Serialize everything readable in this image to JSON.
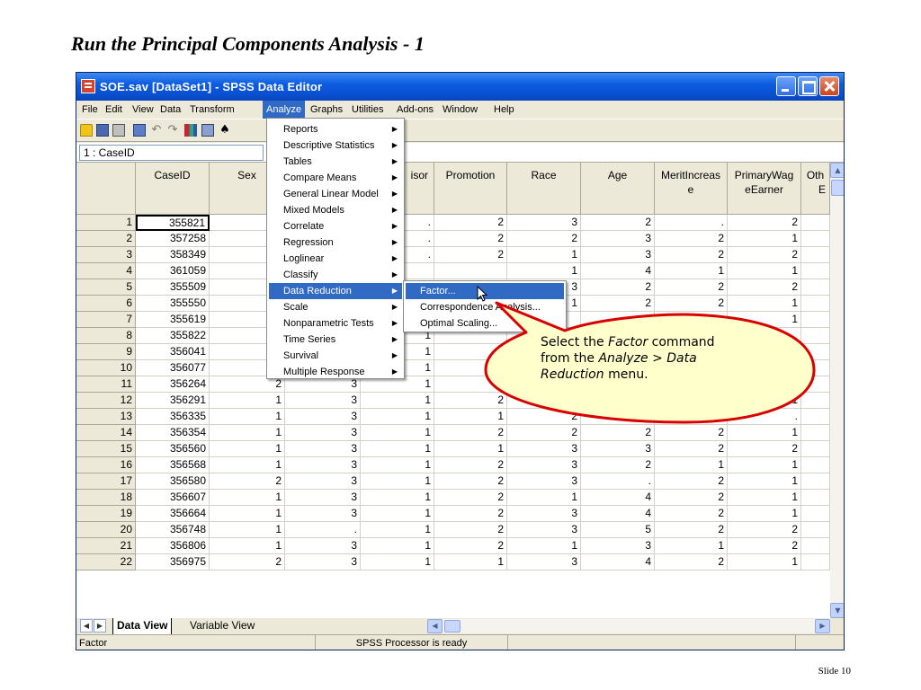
{
  "slide": {
    "title": "Run the Principal Components Analysis - 1",
    "number": "Slide 10"
  },
  "window": {
    "title": "SOE.sav [DataSet1] - SPSS Data Editor"
  },
  "menubar": [
    "File",
    "Edit",
    "View",
    "Data",
    "Transform",
    "Analyze",
    "Graphs",
    "Utilities",
    "Add-ons",
    "Window",
    "Help"
  ],
  "toolbar_icons": [
    "open-icon",
    "save-icon",
    "print-icon",
    "dialog-recall-icon",
    "undo-icon",
    "redo-icon",
    "goto-case-icon",
    "variables-icon",
    "find-icon"
  ],
  "cell_editor": {
    "ref": "1 : CaseID"
  },
  "columns": [
    "CaseID",
    "Sex",
    "",
    "isor",
    "Promotion",
    "Race",
    "Age",
    "MeritIncrease",
    "PrimaryWageEarner",
    "Oth E"
  ],
  "column_headers_display": {
    "c0": "CaseID",
    "c1": "Sex",
    "c3": "isor",
    "c4": "Promotion",
    "c5": "Race",
    "c6": "Age",
    "c7a": "MeritIncreas",
    "c7b": "e",
    "c8a": "PrimaryWag",
    "c8b": "eEarner",
    "c9a": "Oth",
    "c9b": "E"
  },
  "rows": [
    {
      "n": "1",
      "v": [
        "355821",
        "",
        "",
        ".",
        "2",
        "3",
        "2",
        ".",
        "2"
      ]
    },
    {
      "n": "2",
      "v": [
        "357258",
        "",
        "",
        ".",
        "2",
        "2",
        "3",
        "2",
        "1"
      ]
    },
    {
      "n": "3",
      "v": [
        "358349",
        "",
        "",
        ".",
        "2",
        "1",
        "3",
        "2",
        "2"
      ]
    },
    {
      "n": "4",
      "v": [
        "361059",
        "",
        "",
        "",
        "",
        "1",
        "4",
        "1",
        "1"
      ]
    },
    {
      "n": "5",
      "v": [
        "355509",
        "",
        "",
        "",
        "",
        "3",
        "2",
        "2",
        "2"
      ]
    },
    {
      "n": "6",
      "v": [
        "355550",
        "",
        "",
        "",
        "",
        "1",
        "2",
        "2",
        "1"
      ]
    },
    {
      "n": "7",
      "v": [
        "355619",
        "",
        "",
        "1",
        "",
        "",
        "",
        "",
        "1"
      ]
    },
    {
      "n": "8",
      "v": [
        "355822",
        "",
        "",
        "1",
        "",
        "",
        "",
        "",
        ""
      ]
    },
    {
      "n": "9",
      "v": [
        "356041",
        "",
        "",
        "1",
        "",
        "",
        "",
        "",
        ""
      ]
    },
    {
      "n": "10",
      "v": [
        "356077",
        "1",
        "3",
        "1",
        "2",
        "",
        "",
        "",
        "2"
      ]
    },
    {
      "n": "11",
      "v": [
        "356264",
        "2",
        "3",
        "1",
        "2",
        ".",
        "",
        "2",
        "."
      ]
    },
    {
      "n": "12",
      "v": [
        "356291",
        "1",
        "3",
        "1",
        "2",
        "3",
        "3",
        "2",
        "1"
      ]
    },
    {
      "n": "13",
      "v": [
        "356335",
        "1",
        "3",
        "1",
        "1",
        "2",
        "2",
        "2",
        "."
      ]
    },
    {
      "n": "14",
      "v": [
        "356354",
        "1",
        "3",
        "1",
        "2",
        "2",
        "2",
        "2",
        "1"
      ]
    },
    {
      "n": "15",
      "v": [
        "356560",
        "1",
        "3",
        "1",
        "1",
        "3",
        "3",
        "2",
        "2"
      ]
    },
    {
      "n": "16",
      "v": [
        "356568",
        "1",
        "3",
        "1",
        "2",
        "3",
        "2",
        "1",
        "1"
      ]
    },
    {
      "n": "17",
      "v": [
        "356580",
        "2",
        "3",
        "1",
        "2",
        "3",
        ".",
        "2",
        "1"
      ]
    },
    {
      "n": "18",
      "v": [
        "356607",
        "1",
        "3",
        "1",
        "2",
        "1",
        "4",
        "2",
        "1"
      ]
    },
    {
      "n": "19",
      "v": [
        "356664",
        "1",
        "3",
        "1",
        "2",
        "3",
        "4",
        "2",
        "1"
      ]
    },
    {
      "n": "20",
      "v": [
        "356748",
        "1",
        ".",
        "1",
        "2",
        "3",
        "5",
        "2",
        "2"
      ]
    },
    {
      "n": "21",
      "v": [
        "356806",
        "1",
        "3",
        "1",
        "2",
        "1",
        "3",
        "1",
        "2"
      ]
    },
    {
      "n": "22",
      "v": [
        "356975",
        "2",
        "3",
        "1",
        "1",
        "3",
        "4",
        "2",
        "1"
      ]
    }
  ],
  "tabs": {
    "data_view": "Data View",
    "variable_view": "Variable View"
  },
  "status": {
    "left": "Factor",
    "center": "SPSS Processor is ready"
  },
  "analyze_menu": [
    {
      "label": "Reports",
      "submenu": true
    },
    {
      "label": "Descriptive Statistics",
      "submenu": true
    },
    {
      "label": "Tables",
      "submenu": true
    },
    {
      "label": "Compare Means",
      "submenu": true
    },
    {
      "label": "General Linear Model",
      "submenu": true
    },
    {
      "label": "Mixed Models",
      "submenu": true
    },
    {
      "label": "Correlate",
      "submenu": true
    },
    {
      "label": "Regression",
      "submenu": true
    },
    {
      "label": "Loglinear",
      "submenu": true
    },
    {
      "label": "Classify",
      "submenu": true
    },
    {
      "label": "Data Reduction",
      "submenu": true,
      "highlighted": true
    },
    {
      "label": "Scale",
      "submenu": true
    },
    {
      "label": "Nonparametric Tests",
      "submenu": true
    },
    {
      "label": "Time Series",
      "submenu": true
    },
    {
      "label": "Survival",
      "submenu": true
    },
    {
      "label": "Multiple Response",
      "submenu": true
    }
  ],
  "data_reduction_menu": [
    {
      "label": "Factor...",
      "highlighted": true
    },
    {
      "label": "Correspondence Analysis..."
    },
    {
      "label": "Optimal Scaling..."
    }
  ],
  "callout": {
    "line1_a": "Select the ",
    "line1_i": "Factor",
    "line1_b": " command",
    "line2_a": "from the ",
    "line2_i": "Analyze > Data",
    "line3_i": "Reduction",
    "line3_b": " menu."
  },
  "colors": {
    "titlebar": "#0c5ce0",
    "menu_highlight": "#316ac5",
    "callout_fill": "#ffffcc",
    "callout_border": "#d90000"
  }
}
